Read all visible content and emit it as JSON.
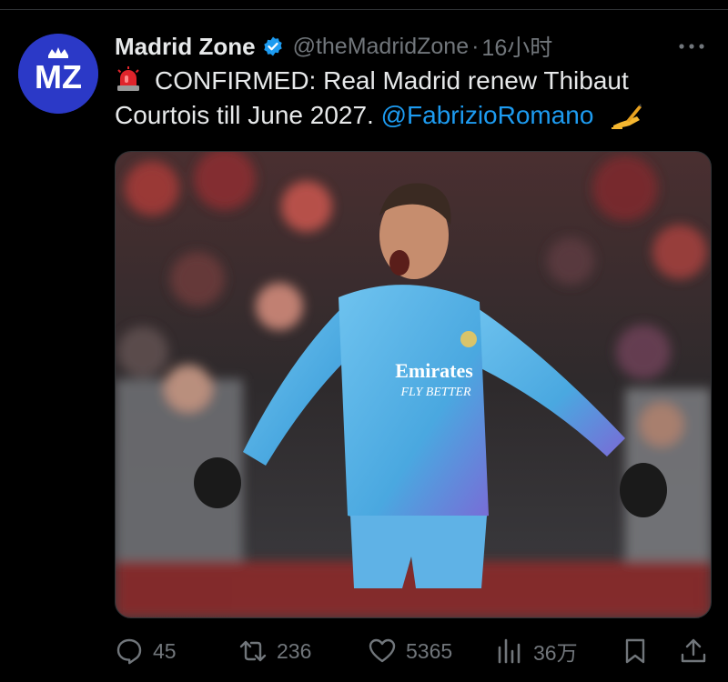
{
  "tweet": {
    "author_name": "Madrid Zone",
    "handle": "@theMadridZone",
    "separator": "·",
    "time": "16小时",
    "more_label": "···",
    "avatar_text": "MZ",
    "text_main": "CONFIRMED: Real Madrid renew Thibaut Courtois till June 2027.",
    "mention": "@FabrizioRomano",
    "emoji_icons": [
      "siren-icon",
      "writing-hand-icon"
    ]
  },
  "media": {
    "jersey_text_1": "Emirates",
    "jersey_text_2": "FLY BETTER"
  },
  "actions": {
    "replies": "45",
    "retweets": "236",
    "likes": "5365",
    "views": "36万"
  },
  "colors": {
    "background": "#000000",
    "text": "#e7e9ea",
    "muted": "#71767b",
    "link": "#1d9bf0",
    "avatar": "#2b39c7"
  }
}
